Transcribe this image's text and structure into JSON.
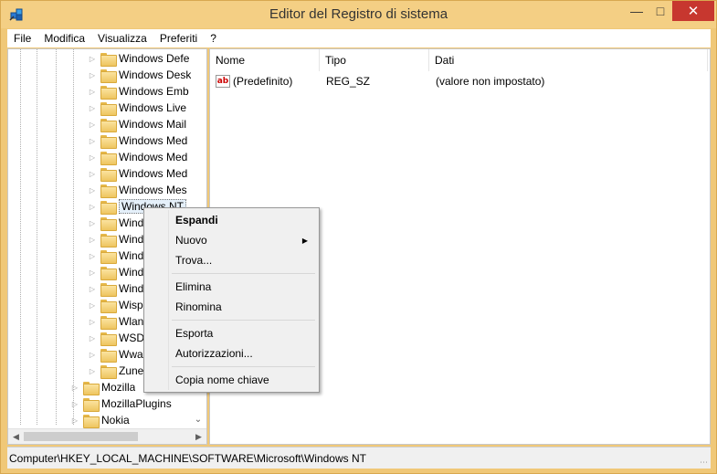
{
  "window": {
    "title": "Editor del Registro di sistema",
    "minimize_glyph": "—",
    "maximize_glyph": "□",
    "close_glyph": "✕"
  },
  "menubar": [
    "File",
    "Modifica",
    "Visualizza",
    "Preferiti",
    "?"
  ],
  "tree": {
    "items": [
      {
        "label": "Windows Defe",
        "level": 3
      },
      {
        "label": "Windows Desk",
        "level": 3
      },
      {
        "label": "Windows Emb",
        "level": 3
      },
      {
        "label": "Windows Live",
        "level": 3
      },
      {
        "label": "Windows Mail",
        "level": 3
      },
      {
        "label": "Windows Med",
        "level": 3
      },
      {
        "label": "Windows Med",
        "level": 3
      },
      {
        "label": "Windows Med",
        "level": 3
      },
      {
        "label": "Windows Mes",
        "level": 3
      },
      {
        "label": "Windows NT",
        "level": 3,
        "selected": true
      },
      {
        "label": "Wind",
        "level": 3
      },
      {
        "label": "Wind",
        "level": 3
      },
      {
        "label": "Wind",
        "level": 3
      },
      {
        "label": "Wind",
        "level": 3
      },
      {
        "label": "Wind",
        "level": 3
      },
      {
        "label": "Wisp",
        "level": 3
      },
      {
        "label": "Wlan",
        "level": 3
      },
      {
        "label": "WSDA",
        "level": 3
      },
      {
        "label": "Wwa",
        "level": 3
      },
      {
        "label": "Zune",
        "level": 3
      },
      {
        "label": "Mozilla",
        "level": 2
      },
      {
        "label": "MozillaPlugins",
        "level": 2
      },
      {
        "label": "Nokia",
        "level": 2
      }
    ]
  },
  "list": {
    "columns": [
      "Nome",
      "Tipo",
      "Dati"
    ],
    "rows": [
      {
        "icon": "ab",
        "name": "(Predefinito)",
        "type": "REG_SZ",
        "data": "(valore non impostato)"
      }
    ]
  },
  "statusbar": {
    "path": "Computer\\HKEY_LOCAL_MACHINE\\SOFTWARE\\Microsoft\\Windows NT"
  },
  "context_menu": {
    "items": [
      {
        "label": "Espandi",
        "bold": true
      },
      {
        "label": "Nuovo",
        "submenu": true
      },
      {
        "label": "Trova..."
      },
      {
        "label": "Elimina"
      },
      {
        "label": "Rinomina"
      },
      {
        "label": "Esporta"
      },
      {
        "label": "Autorizzazioni..."
      },
      {
        "label": "Copia nome chiave"
      }
    ]
  }
}
